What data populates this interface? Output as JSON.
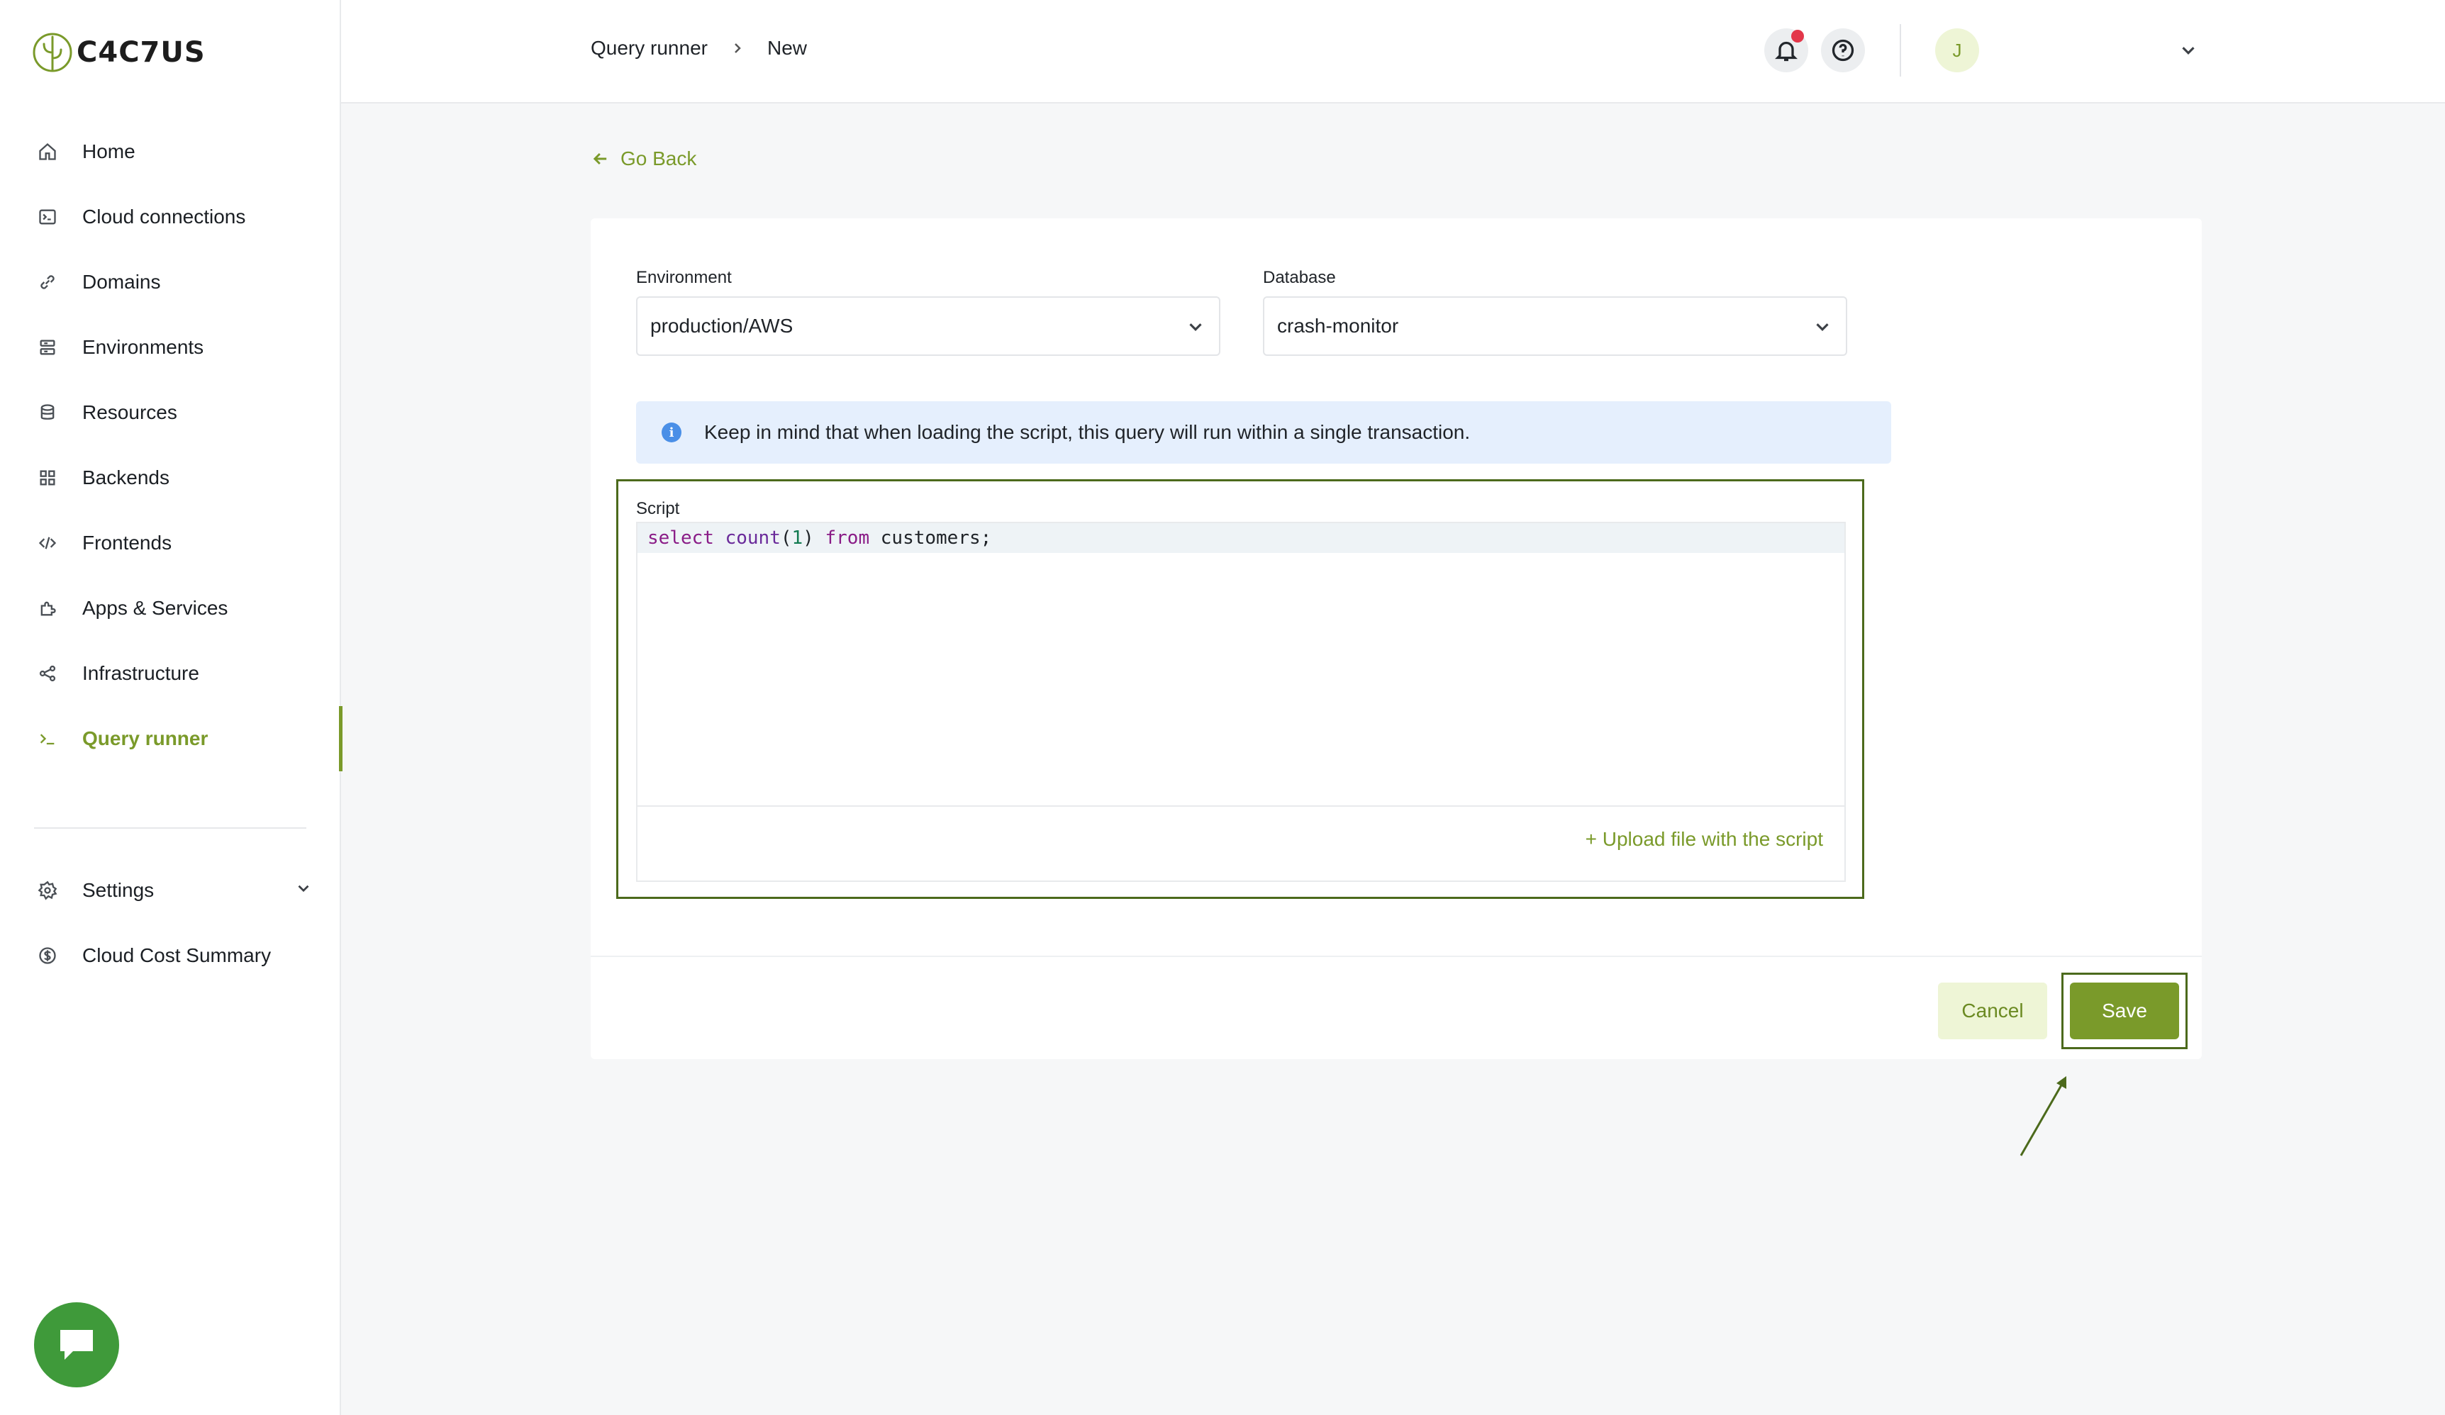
{
  "brand": {
    "logo_text": "C4C7US"
  },
  "sidebar": {
    "items": [
      {
        "label": "Home",
        "icon": "home-icon"
      },
      {
        "label": "Cloud connections",
        "icon": "terminal-box-icon"
      },
      {
        "label": "Domains",
        "icon": "link-icon"
      },
      {
        "label": "Environments",
        "icon": "environments-icon"
      },
      {
        "label": "Resources",
        "icon": "database-icon"
      },
      {
        "label": "Backends",
        "icon": "grid-icon"
      },
      {
        "label": "Frontends",
        "icon": "code-icon"
      },
      {
        "label": "Apps & Services",
        "icon": "puzzle-icon"
      },
      {
        "label": "Infrastructure",
        "icon": "share-nodes-icon"
      },
      {
        "label": "Query runner",
        "icon": "prompt-icon",
        "active": true
      }
    ],
    "bottom_items": [
      {
        "label": "Settings",
        "icon": "gear-icon"
      },
      {
        "label": "Cloud Cost Summary",
        "icon": "dollar-circle-icon"
      }
    ]
  },
  "header": {
    "breadcrumb": [
      "Query runner",
      "New"
    ],
    "avatar_initial": "J",
    "notification_dot_color": "#e3374a"
  },
  "main": {
    "go_back_label": "Go Back",
    "environment": {
      "label": "Environment",
      "value": "production/AWS"
    },
    "database": {
      "label": "Database",
      "value": "crash-monitor"
    },
    "info_message": "Keep in mind that when loading the script, this query will run within a single transaction.",
    "script": {
      "label": "Script",
      "code": "select count(1) from customers;",
      "upload_label": "+ Upload file with the script"
    },
    "cancel_label": "Cancel",
    "save_label": "Save"
  },
  "colors": {
    "accent": "#7a9a2a",
    "accent_light": "#eef5d6",
    "info_bg": "#e5effd",
    "highlight_frame": "#4c6a1c",
    "chat_button": "#3f9a3a"
  }
}
